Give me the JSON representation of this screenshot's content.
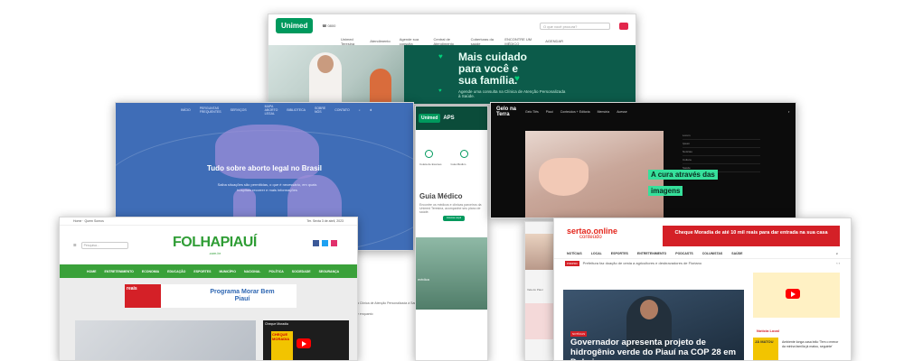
{
  "unimed": {
    "logo": "Unimed",
    "search_placeholder": "O que você procura?",
    "nav": [
      "Unimed Teresina",
      "Atendimento",
      "Agende sua consulta",
      "Central de Atendimento",
      "Coberturas da saúde"
    ],
    "right_links": [
      "ENCONTRE UM MÉDICO",
      "AGENDAR"
    ],
    "hero_title": "Mais cuidado para você e sua família.",
    "hero_sub": "Agende uma consulta na Clínica de Atenção Personalizada à Saúde."
  },
  "aborto": {
    "nav": [
      "INÍCIO",
      "PERGUNTAS FREQUENTES",
      "SERVIÇOS",
      "BIBLIOTECA",
      "SOBRE NÓS",
      "CONTATO"
    ],
    "logo_text": "MAPA ABORTO LEGAL",
    "title": "Tudo sobre aborto legal no Brasil",
    "sub": "Saiba situações são permitidas, o que é necessário, em quais hospitais recorrer e mais informações"
  },
  "guia": {
    "logo": "Unimed",
    "aps": "APS",
    "icons": [
      "Coleta de Exames",
      "Guia Médico"
    ],
    "title": "Guia Médico",
    "desc": "Encontre os médicos e clínicas parceiros da Unimed Teresina, acompanhe seu plano de saúde.",
    "button": "Acesse aqui",
    "snippet": "médica"
  },
  "gelo": {
    "logo": "Gelo na Terra",
    "nav": [
      "Gelo Tiês",
      "Piauí",
      "Conteúdos + Editoria",
      "Memória",
      "Acesse"
    ],
    "caption": "A cura através das imagens",
    "list": [
      "Lorem",
      "Ipsum",
      "Notícias",
      "Cultura",
      "Saúde"
    ]
  },
  "folha": {
    "top_left": "Home · Quem Somos",
    "top_right": "Ter. Sexta 3 de abril, 2023",
    "search_placeholder": "Pesquisa...",
    "logo": "FOLHAPIAUÍ",
    "logo_sub": ".com.br",
    "nav": [
      "HOME",
      "ENTRETENIMENTO",
      "ECONOMIA",
      "EDUCAÇÃO",
      "ESPORTES",
      "MUNICÍPIO",
      "NACIONAL",
      "POLÍTICA",
      "SOCIEDADE",
      "SEGURANÇA"
    ],
    "banner_left": "reais",
    "banner_title": "Programa Morar Bem Piauí",
    "video_title": "Cheque Moradia",
    "ad_text": "CHEQUE MORADIA"
  },
  "sertao": {
    "logo": "sertao.online",
    "logo_sub": "conteúdo",
    "banner": "Cheque Moradia de até 10 mil reais para dar entrada na sua casa",
    "nav": [
      "NOTÍCIAS",
      "LOCAL",
      "ESPORTES",
      "ENTRETENIMENTO",
      "PODCASTS",
      "COLUNISTAS",
      "SAÚDE"
    ],
    "ticker_tag": "PIRIPIRI",
    "ticker_text": "Prefeitura faz doação de cesta a agricultores e desbravadores de Floriano",
    "main_tag": "NOTÍCIAS",
    "headline": "Governador apresenta projeto de hidrogênio verde do Piauí na COP 28 em Dubai",
    "side_label": "Notícia Local",
    "side_text": "Ambiente longa casa leão 'Tem o menor da minha família já matou, seguinte'",
    "thumb_text": "JÁ MATOU"
  },
  "strip": {
    "label": "Vela do Piauí"
  },
  "guia_footer": "à Clínica de Atenção Personalizada à Saúde e enquanto"
}
